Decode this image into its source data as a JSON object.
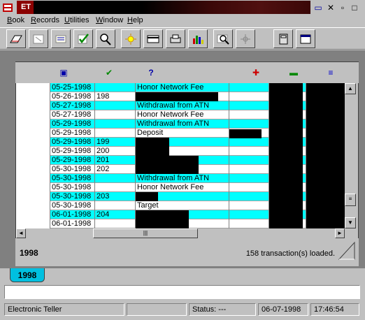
{
  "window": {
    "title_short": "ET"
  },
  "menu": [
    "Book",
    "Records",
    "Utilities",
    "Window",
    "Help"
  ],
  "toolbar_icons": [
    "open-book-icon",
    "split-icon",
    "sort-icon",
    "check-icon",
    "search-icon",
    "sun-icon",
    "card-icon",
    "print-icon",
    "chart-icon",
    "zoom-icon",
    "crosshair-icon",
    "calculator-icon",
    "window-icon"
  ],
  "columns": [
    "date-icon",
    "check-mark-icon",
    "question-icon",
    "withdrawal-icon",
    "cleared-icon",
    "deposit-icon"
  ],
  "rows": [
    {
      "date": "05-25-1998",
      "num": "",
      "desc": "Honor Network Fee",
      "cyan": true
    },
    {
      "date": "05-26-1998",
      "num": "198",
      "desc": "",
      "cyan": false
    },
    {
      "date": "05-27-1998",
      "num": "",
      "desc": "Withdrawal from ATN",
      "cyan": true
    },
    {
      "date": "05-27-1998",
      "num": "",
      "desc": "Honor Network Fee",
      "cyan": false
    },
    {
      "date": "05-29-1998",
      "num": "",
      "desc": "Withdrawal from ATN",
      "cyan": true
    },
    {
      "date": "05-29-1998",
      "num": "",
      "desc": "Deposit",
      "cyan": false
    },
    {
      "date": "05-29-1998",
      "num": "199",
      "desc": "",
      "cyan": true
    },
    {
      "date": "05-29-1998",
      "num": "200",
      "desc": "",
      "cyan": false
    },
    {
      "date": "05-29-1998",
      "num": "201",
      "desc": "",
      "cyan": true
    },
    {
      "date": "05-30-1998",
      "num": "202",
      "desc": "",
      "cyan": false
    },
    {
      "date": "05-30-1998",
      "num": "",
      "desc": "Withdrawal from ATN",
      "cyan": true
    },
    {
      "date": "05-30-1998",
      "num": "",
      "desc": "Honor Network Fee",
      "cyan": false
    },
    {
      "date": "05-30-1998",
      "num": "203",
      "desc": "",
      "cyan": true
    },
    {
      "date": "05-30-1998",
      "num": "",
      "desc": "Target",
      "cyan": false
    },
    {
      "date": "06-01-1998",
      "num": "204",
      "desc": "",
      "cyan": true
    },
    {
      "date": "06-01-1998",
      "num": "",
      "desc": "",
      "cyan": false
    }
  ],
  "footer": {
    "year": "1998",
    "loaded": "158 transaction(s) loaded."
  },
  "tab": {
    "label": "1998"
  },
  "status": {
    "app": "Electronic Teller",
    "status": "Status: ---",
    "date": "06-07-1998",
    "time": "17:46:54"
  },
  "colors": {
    "row_highlight": "#00ffff",
    "tab": "#00c0e0",
    "workspace": "#808080"
  }
}
